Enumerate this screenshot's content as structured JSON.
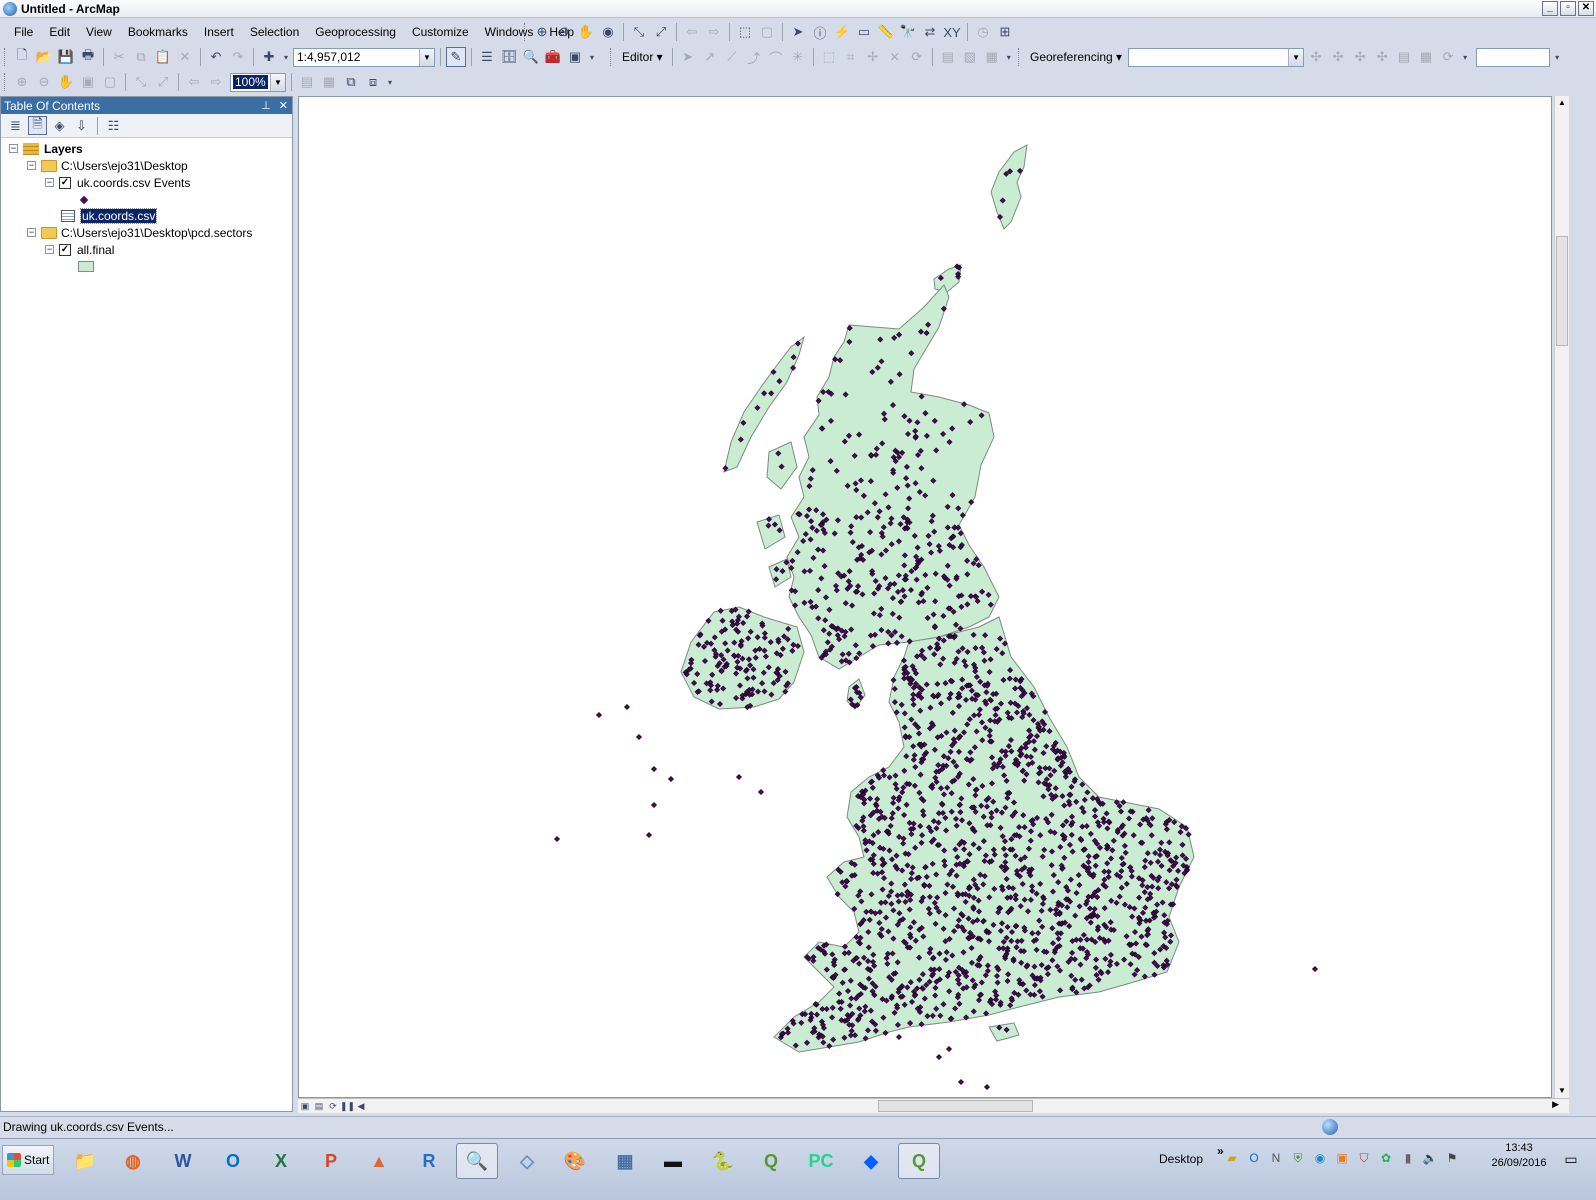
{
  "window": {
    "title": "Untitled - ArcMap",
    "min": "_",
    "max": "▫",
    "close": "✕"
  },
  "menu": [
    "File",
    "Edit",
    "View",
    "Bookmarks",
    "Insert",
    "Selection",
    "Geoprocessing",
    "Customize",
    "Windows",
    "Help"
  ],
  "toolbar": {
    "scale_value": "1:4,957,012",
    "zoom_value": "100%",
    "editor_label": "Editor ▾",
    "georef_label": "Georeferencing ▾",
    "georef_layer": ""
  },
  "toc": {
    "title": "Table Of Contents",
    "root": "Layers",
    "groups": [
      {
        "path": "C:\\Users\\ejo31\\Desktop",
        "layer": "uk.coords.csv Events",
        "table": "uk.coords.csv"
      },
      {
        "path": "C:\\Users\\ejo31\\Desktop\\pcd.sectors",
        "layer": "all.final"
      }
    ]
  },
  "map": {
    "land_color": "#c9ecd3",
    "land_stroke": "#7d8b80",
    "point_color": "#4c0a5c",
    "point_stroke": "#1a0220"
  },
  "status": {
    "text": "Drawing uk.coords.csv Events..."
  },
  "taskbar": {
    "start": "Start",
    "desktop": "Desktop",
    "desktop_arrow": "»",
    "clock_time": "13:43",
    "clock_date": "26/09/2016"
  }
}
